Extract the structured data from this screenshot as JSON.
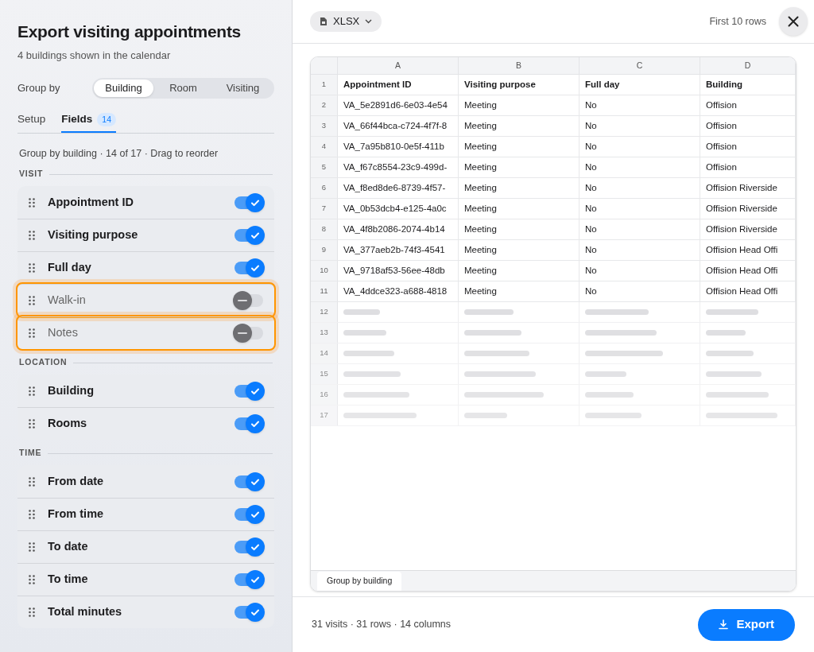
{
  "panel": {
    "title": "Export visiting appointments",
    "subtitle": "4 buildings shown in the calendar",
    "group_by": {
      "label": "Group by",
      "options": [
        {
          "label": "Building",
          "selected": true
        },
        {
          "label": "Room",
          "selected": false
        },
        {
          "label": "Visiting",
          "selected": false
        }
      ]
    },
    "tabs": [
      {
        "label": "Setup",
        "selected": false
      },
      {
        "label": "Fields",
        "selected": true,
        "badge": "14"
      }
    ],
    "info": "Group by building · 14 of 17 · Drag to reorder",
    "sections": [
      {
        "title": "VISIT",
        "fields": [
          {
            "label": "Appointment ID",
            "on": true,
            "highlighted": false
          },
          {
            "label": "Visiting purpose",
            "on": true,
            "highlighted": false
          },
          {
            "label": "Full day",
            "on": true,
            "highlighted": false
          },
          {
            "label": "Walk-in",
            "on": false,
            "highlighted": true
          },
          {
            "label": "Notes",
            "on": false,
            "highlighted": true
          }
        ]
      },
      {
        "title": "LOCATION",
        "fields": [
          {
            "label": "Building",
            "on": true,
            "highlighted": false
          },
          {
            "label": "Rooms",
            "on": true,
            "highlighted": false
          }
        ]
      },
      {
        "title": "TIME",
        "fields": [
          {
            "label": "From date",
            "on": true,
            "highlighted": false
          },
          {
            "label": "From time",
            "on": true,
            "highlighted": false
          },
          {
            "label": "To date",
            "on": true,
            "highlighted": false
          },
          {
            "label": "To time",
            "on": true,
            "highlighted": false
          },
          {
            "label": "Total minutes",
            "on": true,
            "highlighted": false
          }
        ]
      }
    ]
  },
  "preview": {
    "format": "XLSX",
    "note": "First 10 rows",
    "sheet": {
      "columns": [
        "A",
        "B",
        "C",
        "D"
      ],
      "rows": [
        {
          "number": "1",
          "cells": [
            "Appointment ID",
            "Visiting purpose",
            "Full day",
            "Building"
          ]
        },
        {
          "number": "2",
          "cells": [
            "VA_5e2891d6-6e03-4e54",
            "Meeting",
            "No",
            "Offision"
          ]
        },
        {
          "number": "3",
          "cells": [
            "VA_66f44bca-c724-4f7f-8",
            "Meeting",
            "No",
            "Offision"
          ]
        },
        {
          "number": "4",
          "cells": [
            "VA_7a95b810-0e5f-411b",
            "Meeting",
            "No",
            "Offision"
          ]
        },
        {
          "number": "5",
          "cells": [
            "VA_f67c8554-23c9-499d-",
            "Meeting",
            "No",
            "Offision"
          ]
        },
        {
          "number": "6",
          "cells": [
            "VA_f8ed8de6-8739-4f57-",
            "Meeting",
            "No",
            "Offision Riverside"
          ]
        },
        {
          "number": "7",
          "cells": [
            "VA_0b53dcb4-e125-4a0c",
            "Meeting",
            "No",
            "Offision Riverside"
          ]
        },
        {
          "number": "8",
          "cells": [
            "VA_4f8b2086-2074-4b14",
            "Meeting",
            "No",
            "Offision Riverside"
          ]
        },
        {
          "number": "9",
          "cells": [
            "VA_377aeb2b-74f3-4541",
            "Meeting",
            "No",
            "Offision Head Offi"
          ]
        },
        {
          "number": "10",
          "cells": [
            "VA_9718af53-56ee-48db",
            "Meeting",
            "No",
            "Offision Head Offi"
          ]
        },
        {
          "number": "11",
          "cells": [
            "VA_4ddce323-a688-4818",
            "Meeting",
            "No",
            "Offision Head Offi"
          ]
        }
      ],
      "loading_rows": [
        "12",
        "13",
        "14",
        "15",
        "16",
        "17"
      ],
      "sheet_tab": "Group by building"
    },
    "summary": "31 visits · 31 rows · 14 columns",
    "export_label": "Export"
  }
}
